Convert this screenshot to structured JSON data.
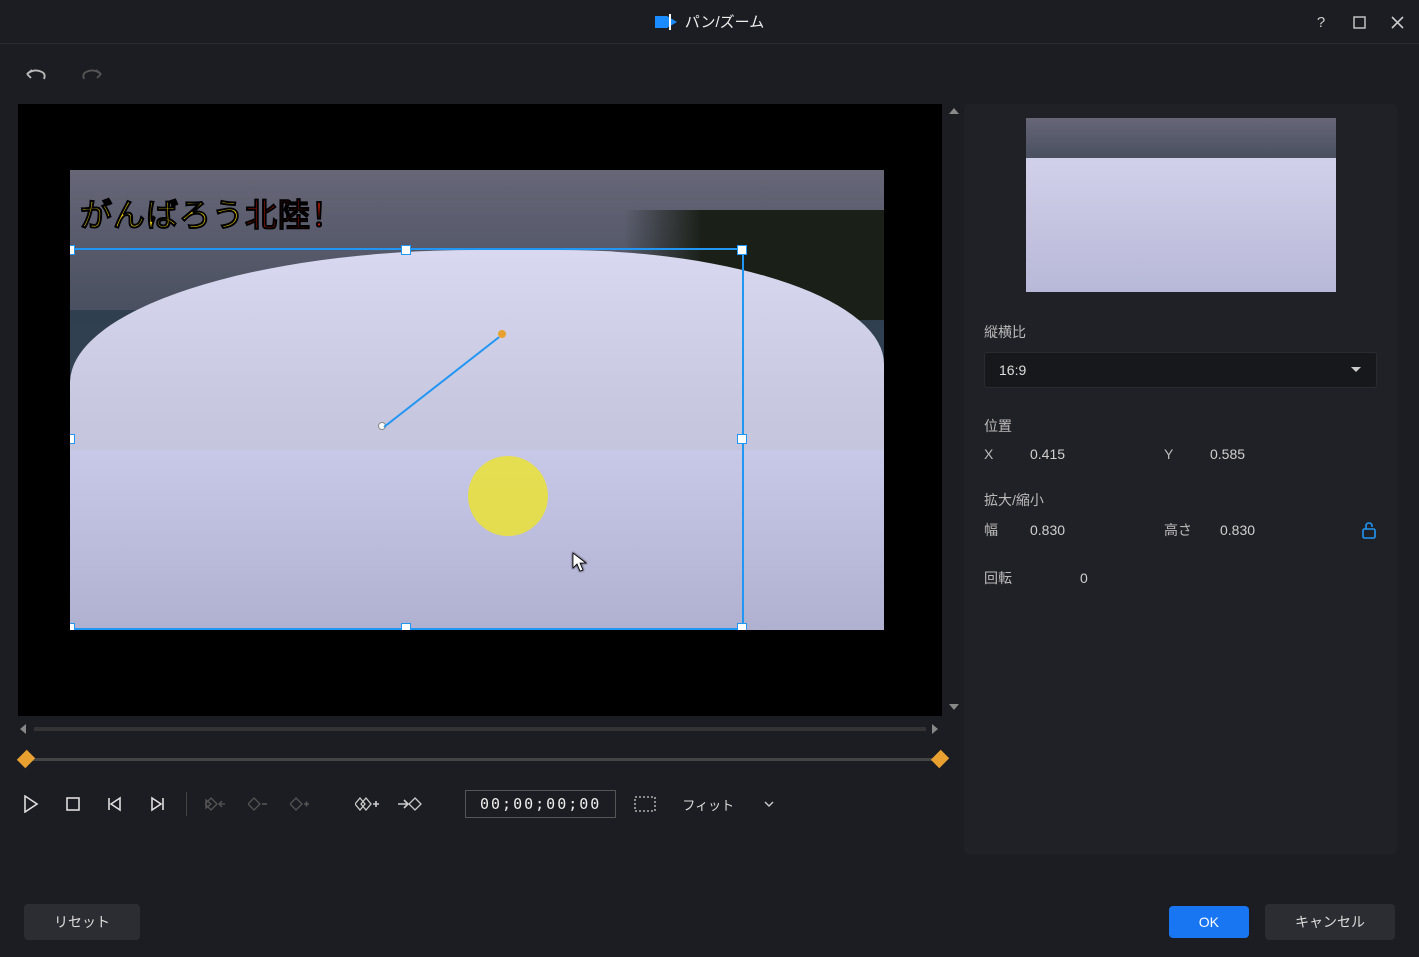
{
  "window": {
    "title": "パン/ズーム"
  },
  "overlay": {
    "part1": "がんばろう",
    "part2": "北陸！"
  },
  "props": {
    "aspect_label": "縦横比",
    "aspect_value": "16:9",
    "position_label": "位置",
    "x_label": "X",
    "x_value": "0.415",
    "y_label": "Y",
    "y_value": "0.585",
    "scale_label": "拡大/縮小",
    "width_label": "幅",
    "width_value": "0.830",
    "height_label": "高さ",
    "height_value": "0.830",
    "rotation_label": "回転",
    "rotation_value": "0"
  },
  "playback": {
    "timecode": "00;00;00;00",
    "fit": "フィット"
  },
  "footer": {
    "reset": "リセット",
    "ok": "OK",
    "cancel": "キャンセル"
  }
}
